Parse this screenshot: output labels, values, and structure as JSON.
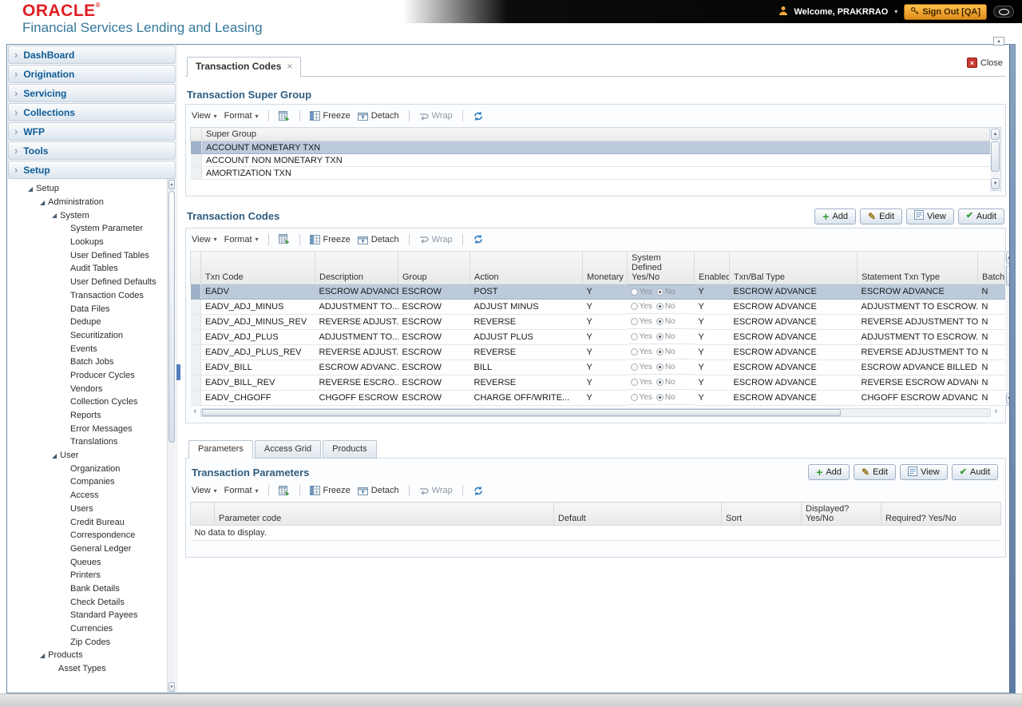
{
  "colors": {
    "oracle_red": "#e01e23",
    "title_blue": "#2f5d80",
    "selected_row": "#bccadb",
    "signout_orange": "#f0a32f",
    "scrollbar_blue": "#5c7aa2"
  },
  "header": {
    "brand": "ORACLE",
    "registered": "®",
    "subtitle": "Financial Services Lending and Leasing",
    "welcome": "Welcome, PRAKRRAO",
    "sign_out": "Sign Out [QA]"
  },
  "sidebar": {
    "accordion": [
      {
        "label": "DashBoard"
      },
      {
        "label": "Origination"
      },
      {
        "label": "Servicing"
      },
      {
        "label": "Collections"
      },
      {
        "label": "WFP"
      },
      {
        "label": "Tools"
      },
      {
        "label": "Setup"
      }
    ],
    "tree": [
      {
        "label": "Setup",
        "level": 0,
        "expandable": true
      },
      {
        "label": "Administration",
        "level": 1,
        "expandable": true
      },
      {
        "label": "System",
        "level": 2,
        "expandable": true
      },
      {
        "label": "System Parameter",
        "level": 3
      },
      {
        "label": "Lookups",
        "level": 3
      },
      {
        "label": "User Defined Tables",
        "level": 3
      },
      {
        "label": "Audit Tables",
        "level": 3
      },
      {
        "label": "User Defined Defaults",
        "level": 3
      },
      {
        "label": "Transaction Codes",
        "level": 3
      },
      {
        "label": "Data Files",
        "level": 3
      },
      {
        "label": "Dedupe",
        "level": 3
      },
      {
        "label": "Securitization",
        "level": 3
      },
      {
        "label": "Events",
        "level": 3
      },
      {
        "label": "Batch Jobs",
        "level": 3
      },
      {
        "label": "Producer Cycles",
        "level": 3
      },
      {
        "label": "Vendors",
        "level": 3
      },
      {
        "label": "Collection Cycles",
        "level": 3
      },
      {
        "label": "Reports",
        "level": 3
      },
      {
        "label": "Error Messages",
        "level": 3
      },
      {
        "label": "Translations",
        "level": 3
      },
      {
        "label": "User",
        "level": 2,
        "expandable": true
      },
      {
        "label": "Organization",
        "level": 3
      },
      {
        "label": "Companies",
        "level": 3
      },
      {
        "label": "Access",
        "level": 3
      },
      {
        "label": "Users",
        "level": 3
      },
      {
        "label": "Credit Bureau",
        "level": 3
      },
      {
        "label": "Correspondence",
        "level": 3
      },
      {
        "label": "General Ledger",
        "level": 3
      },
      {
        "label": "Queues",
        "level": 3
      },
      {
        "label": "Printers",
        "level": 3
      },
      {
        "label": "Bank Details",
        "level": 3
      },
      {
        "label": "Check Details",
        "level": 3
      },
      {
        "label": "Standard Payees",
        "level": 3
      },
      {
        "label": "Currencies",
        "level": 3
      },
      {
        "label": "Zip Codes",
        "level": 3
      },
      {
        "label": "Products",
        "level": 1,
        "expandable": true
      },
      {
        "label": "Asset Types",
        "level": 2
      }
    ]
  },
  "content": {
    "tab": {
      "label": "Transaction Codes"
    },
    "close_label": "Close",
    "toolbar": {
      "view": "View",
      "format": "Format",
      "freeze": "Freeze",
      "detach": "Detach",
      "wrap": "Wrap"
    },
    "actions": {
      "add": "Add",
      "edit": "Edit",
      "view": "View",
      "audit": "Audit"
    },
    "radio_labels": {
      "yes": "Yes",
      "no": "No"
    },
    "super_group": {
      "title": "Transaction Super Group",
      "columns": [
        "Super Group"
      ],
      "rows": [
        "ACCOUNT MONETARY TXN",
        "ACCOUNT NON MONETARY TXN",
        "AMORTIZATION TXN"
      ],
      "selected_index": 0
    },
    "txn_codes": {
      "title": "Transaction Codes",
      "columns": [
        "Txn Code",
        "Description",
        "Group",
        "Action",
        "Monetary",
        "System Defined Yes/No",
        "Enabled",
        "Txn/Bal Type",
        "Statement Txn Type",
        "Batch"
      ],
      "selected_index": 0,
      "rows": [
        {
          "txn_code": "EADV",
          "description": "ESCROW ADVANCE",
          "group": "ESCROW",
          "action": "POST",
          "monetary": "Y",
          "system_defined": "No",
          "enabled": "Y",
          "txn_bal_type": "ESCROW ADVANCE",
          "statement_txn_type": "ESCROW ADVANCE",
          "batch": "N"
        },
        {
          "txn_code": "EADV_ADJ_MINUS",
          "description": "ADJUSTMENT TO...",
          "group": "ESCROW",
          "action": "ADJUST MINUS",
          "monetary": "Y",
          "system_defined": "No",
          "enabled": "Y",
          "txn_bal_type": "ESCROW ADVANCE",
          "statement_txn_type": "ADJUSTMENT TO ESCROW...",
          "batch": "N"
        },
        {
          "txn_code": "EADV_ADJ_MINUS_REV",
          "description": "REVERSE ADJUST...",
          "group": "ESCROW",
          "action": "REVERSE",
          "monetary": "Y",
          "system_defined": "No",
          "enabled": "Y",
          "txn_bal_type": "ESCROW ADVANCE",
          "statement_txn_type": "REVERSE ADJUSTMENT TO...",
          "batch": "N"
        },
        {
          "txn_code": "EADV_ADJ_PLUS",
          "description": "ADJUSTMENT TO...",
          "group": "ESCROW",
          "action": "ADJUST PLUS",
          "monetary": "Y",
          "system_defined": "No",
          "enabled": "Y",
          "txn_bal_type": "ESCROW ADVANCE",
          "statement_txn_type": "ADJUSTMENT TO ESCROW...",
          "batch": "N"
        },
        {
          "txn_code": "EADV_ADJ_PLUS_REV",
          "description": "REVERSE ADJUST...",
          "group": "ESCROW",
          "action": "REVERSE",
          "monetary": "Y",
          "system_defined": "No",
          "enabled": "Y",
          "txn_bal_type": "ESCROW ADVANCE",
          "statement_txn_type": "REVERSE ADJUSTMENT TO...",
          "batch": "N"
        },
        {
          "txn_code": "EADV_BILL",
          "description": "ESCROW ADVANC...",
          "group": "ESCROW",
          "action": "BILL",
          "monetary": "Y",
          "system_defined": "No",
          "enabled": "Y",
          "txn_bal_type": "ESCROW ADVANCE",
          "statement_txn_type": "ESCROW ADVANCE BILLED",
          "batch": "N"
        },
        {
          "txn_code": "EADV_BILL_REV",
          "description": "REVERSE ESCRO...",
          "group": "ESCROW",
          "action": "REVERSE",
          "monetary": "Y",
          "system_defined": "No",
          "enabled": "Y",
          "txn_bal_type": "ESCROW ADVANCE",
          "statement_txn_type": "REVERSE ESCROW ADVANC...",
          "batch": "N"
        },
        {
          "txn_code": "EADV_CHGOFF",
          "description": "CHGOFF ESCROW...",
          "group": "ESCROW",
          "action": "CHARGE OFF/WRITE...",
          "monetary": "Y",
          "system_defined": "No",
          "enabled": "Y",
          "txn_bal_type": "ESCROW ADVANCE",
          "statement_txn_type": "CHGOFF ESCROW ADVANCE",
          "batch": "N"
        }
      ]
    },
    "sub_tabs": [
      {
        "label": "Parameters",
        "active": true
      },
      {
        "label": "Access Grid",
        "active": false
      },
      {
        "label": "Products",
        "active": false
      }
    ],
    "parameters": {
      "title": "Transaction Parameters",
      "columns": [
        "Parameter code",
        "Default",
        "Sort",
        "Displayed? Yes/No",
        "Required? Yes/No"
      ],
      "empty_message": "No data to display."
    }
  }
}
